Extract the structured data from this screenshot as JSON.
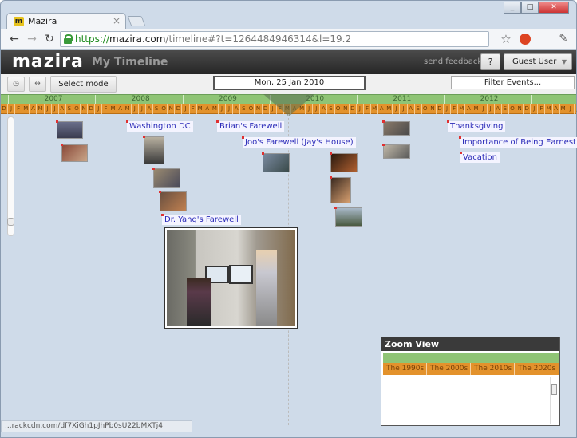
{
  "browser": {
    "tab_title": "Mazira",
    "url_scheme": "https://",
    "url_host": "mazira.com",
    "url_rest": "/timeline#?t=1264484946314&l=19.2",
    "status_url": "...rackcdn.com/df7XiGh1pJhPb0sU22bMXTj4"
  },
  "app": {
    "logo": "mazira",
    "page_title": "My Timeline",
    "feedback": "send feedback",
    "help": "?",
    "user": "Guest User"
  },
  "controls": {
    "select_mode": "Select mode",
    "current_date": "Mon, 25 Jan 2010",
    "filter": "Filter Events..."
  },
  "timeline": {
    "years": [
      "2007",
      "2008",
      "2009",
      "2010",
      "2011",
      "2012"
    ],
    "months": [
      "J",
      "F",
      "M",
      "A",
      "M",
      "J",
      "J",
      "A",
      "S",
      "O",
      "N",
      "D"
    ],
    "events": [
      {
        "label": "Washington DC"
      },
      {
        "label": "Brian's Farewell"
      },
      {
        "label": "Joo's Farewell (Jay's House)"
      },
      {
        "label": "Dr. Yang's Farewell"
      },
      {
        "label": "Thanksgiving"
      },
      {
        "label": "Importance of Being Earnest"
      },
      {
        "label": "Vacation"
      }
    ]
  },
  "zoom_view": {
    "title": "Zoom View",
    "decades": [
      "The 1990s",
      "The 2000s",
      "The 2010s",
      "The 2020s"
    ]
  },
  "colors": {
    "year_bar": "#8fc475",
    "month_bar": "#e3922c",
    "event_text": "#2a2ab8",
    "app_bar": "#262626"
  }
}
